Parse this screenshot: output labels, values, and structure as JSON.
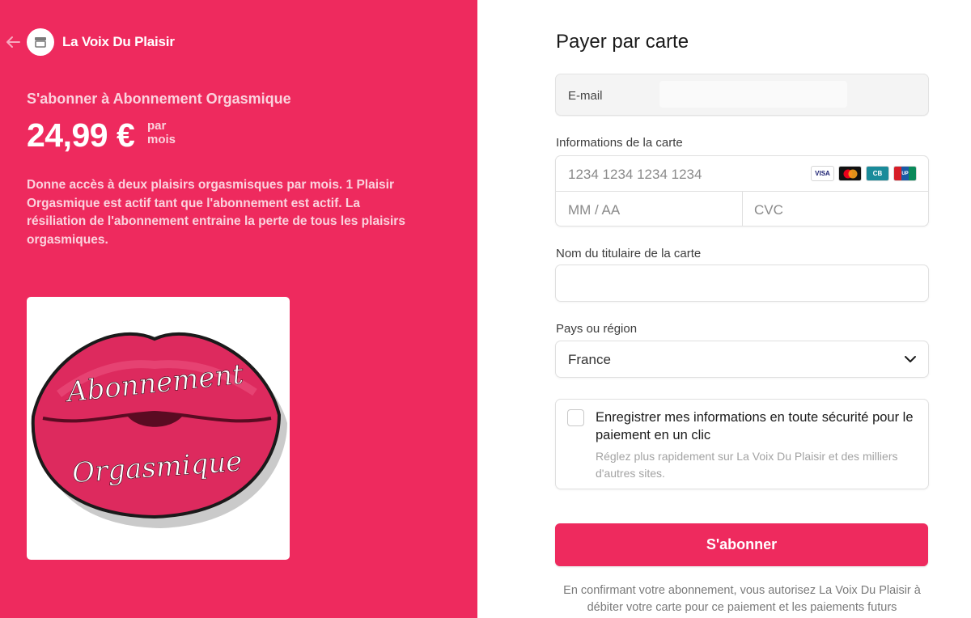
{
  "merchant": {
    "name": "La Voix Du Plaisir",
    "back_icon": "arrow-left-icon",
    "logo_icon": "store-icon"
  },
  "product": {
    "subscribe_title": "S'abonner à Abonnement Orgasmique",
    "price": "24,99 €",
    "period_line1": "par",
    "period_line2": "mois",
    "description": "Donne accès à deux plaisirs orgasmisques par mois. 1 Plaisir Orgasmique est actif tant que l'abonnement est actif. La résiliation de l'abonnement entraine la perte de tous les plaisirs orgasmiques.",
    "image": {
      "line1": "Abonnement",
      "line2": "Orgasmique"
    }
  },
  "form": {
    "title": "Payer par carte",
    "email": {
      "label": "E-mail",
      "value": ""
    },
    "card": {
      "label": "Informations de la carte",
      "number_placeholder": "1234 1234 1234 1234",
      "expiry_placeholder": "MM / AA",
      "cvc_placeholder": "CVC",
      "brands": [
        "VISA",
        "mastercard",
        "CB",
        "UnionPay"
      ]
    },
    "cardholder": {
      "label": "Nom du titulaire de la carte",
      "value": ""
    },
    "country": {
      "label": "Pays ou région",
      "value": "France",
      "icon": "chevron-down-icon"
    },
    "save": {
      "checked": false,
      "title": "Enregistrer mes informations en toute sécurité pour le paiement en un clic",
      "subtitle": "Réglez plus rapidement sur La Voix Du Plaisir et des milliers d'autres sites."
    },
    "submit_label": "S'abonner",
    "legal": "En confirmant votre abonnement, vous autorisez La Voix Du Plaisir à débiter votre carte pour ce paiement et les paiements futurs"
  },
  "colors": {
    "brand": "#ee2a5e",
    "brand_text_muted": "#fbd2dd"
  }
}
